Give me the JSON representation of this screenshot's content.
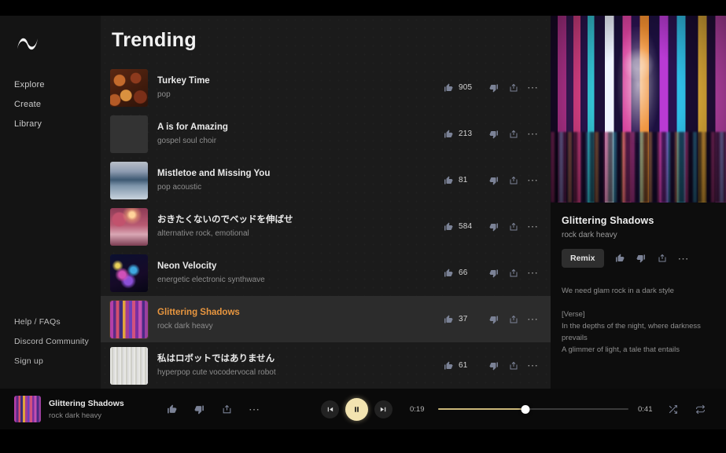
{
  "sidebar": {
    "logo_icon": "wave-logo-icon",
    "top_items": [
      {
        "label": "Explore",
        "name": "sidebar-item-explore"
      },
      {
        "label": "Create",
        "name": "sidebar-item-create"
      },
      {
        "label": "Library",
        "name": "sidebar-item-library"
      }
    ],
    "bottom_items": [
      {
        "label": "Help / FAQs",
        "name": "sidebar-item-help-faqs"
      },
      {
        "label": "Discord Community",
        "name": "sidebar-item-discord-community"
      },
      {
        "label": "Sign up",
        "name": "sidebar-item-sign-up"
      }
    ]
  },
  "main": {
    "title": "Trending",
    "tracks": [
      {
        "title": "Turkey Time",
        "tags": "pop",
        "likes": "905",
        "art": "art1"
      },
      {
        "title": "A is for Amazing",
        "tags": "gospel soul choir",
        "likes": "213",
        "art": "art2"
      },
      {
        "title": "Mistletoe and Missing You",
        "tags": "pop acoustic",
        "likes": "81",
        "art": "art3"
      },
      {
        "title": "おきたくないのでベッドを伸ばせ",
        "tags": "alternative rock, emotional",
        "likes": "584",
        "art": "art4"
      },
      {
        "title": "Neon Velocity",
        "tags": "energetic electronic synthwave",
        "likes": "66",
        "art": "art5"
      },
      {
        "title": "Glittering Shadows",
        "tags": "rock dark heavy",
        "likes": "37",
        "art": "art6",
        "active": true
      },
      {
        "title": "私はロボットではありません",
        "tags": "hyperpop cute vocodervocal robot",
        "likes": "61",
        "art": "art7"
      }
    ]
  },
  "detail": {
    "cover_alt": "neon-city-street-at-night",
    "title": "Glittering Shadows",
    "tags": "rock dark heavy",
    "remix_label": "Remix",
    "lyrics": [
      "We need glam rock in a dark style",
      "",
      "[Verse]",
      "In the depths of the night, where darkness prevails",
      "A glimmer of light, a tale that entails"
    ]
  },
  "player": {
    "title": "Glittering Shadows",
    "tags": "rock dark heavy",
    "current_time": "0:19",
    "total_time": "0:41",
    "progress_percent": 46,
    "state": "playing"
  },
  "colors": {
    "accent": "#e8963f",
    "progress": "#cbb77a",
    "play_button": "#f2e3b0"
  }
}
